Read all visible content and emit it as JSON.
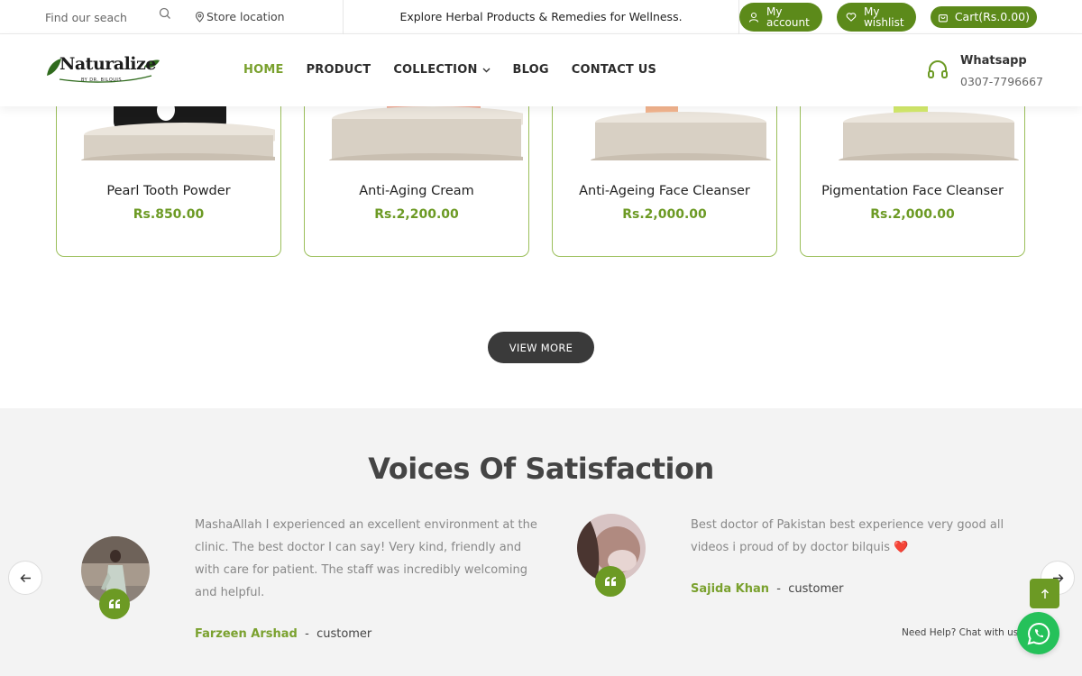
{
  "topbar": {
    "search_placeholder": "Find our seach",
    "store_location": "Store location",
    "promo": "Explore Herbal Products & Remedies for Wellness.",
    "account_label": "My account",
    "wishlist_label": "My wishlist",
    "cart_label": "Cart(Rs.0.00)"
  },
  "nav": {
    "logo_text": "Naturalize",
    "logo_sub": "BY DR. BILQUIS",
    "items": [
      {
        "label": "HOME",
        "active": true
      },
      {
        "label": "PRODUCT"
      },
      {
        "label": "COLLECTION",
        "has_dropdown": true
      },
      {
        "label": "BLOG"
      },
      {
        "label": "CONTACT US"
      }
    ],
    "whatsapp_title": "Whatsapp",
    "whatsapp_phone": "0307-7796667"
  },
  "products": [
    {
      "name": "Pearl Tooth Powder",
      "price": "Rs.850.00"
    },
    {
      "name": "Anti-Aging Cream",
      "price": "Rs.2,200.00"
    },
    {
      "name": "Anti-Ageing Face Cleanser",
      "price": "Rs.2,000.00"
    },
    {
      "name": "Pigmentation Face Cleanser",
      "price": "Rs.2,000.00"
    }
  ],
  "view_more": "VIEW MORE",
  "testimonials": {
    "title": "Voices Of Satisfaction",
    "items": [
      {
        "text_lines": [
          "MashaAllah I experienced an excellent environment at the",
          "clinic. The best doctor I can say! Very kind, friendly and",
          "with care for patient. The staff was incredibly welcoming",
          "and helpful."
        ],
        "name": "Farzeen Arshad",
        "separator": "-",
        "role": "customer"
      },
      {
        "text_lines": [
          "Best doctor of Pakistan best experience very good all",
          "videos i proud of by doctor bilquis ❤️"
        ],
        "name": "Sajida Khan",
        "separator": "-",
        "role": "customer"
      }
    ]
  },
  "chat": {
    "need_help": "Need Help? Chat with us"
  },
  "colors": {
    "brand_green": "#6c9a24",
    "nav_active": "#7aa12e",
    "whatsapp_green": "#25c15a"
  }
}
